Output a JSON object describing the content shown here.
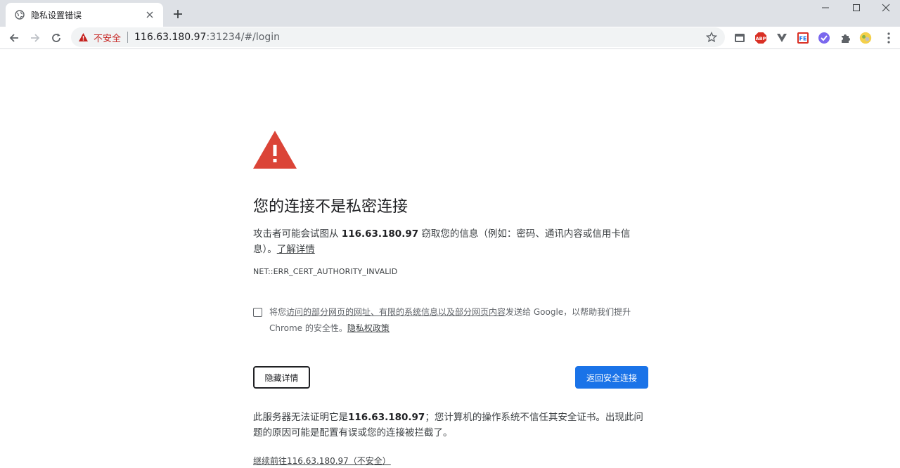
{
  "tab": {
    "title": "隐私设置错误"
  },
  "omnibox": {
    "security_label": "不安全",
    "host": "116.63.180.97",
    "path": ":31234/#/login"
  },
  "extensions": {
    "abp": "ABP",
    "fe": "FE"
  },
  "interstitial": {
    "heading": "您的连接不是私密连接",
    "main_text_pre": "攻击者可能会试图从 ",
    "main_host": "116.63.180.97",
    "main_text_post": " 窃取您的信息（例如：密码、通讯内容或信用卡信息）。",
    "learn_more": "了解详情",
    "error_code": "NET::ERR_CERT_AUTHORITY_INVALID",
    "optin_pre": "将您",
    "optin_link": "访问的部分网页的网址、有限的系统信息以及部分网页内容",
    "optin_post": "发送给 Google，以帮助我们提升 Chrome 的安全性。",
    "privacy_link": "隐私权政策",
    "hide_details_button": "隐藏详情",
    "back_button": "返回安全连接",
    "details_pre": "此服务器无法证明它是",
    "details_host": "116.63.180.97",
    "details_post": "；您计算机的操作系统不信任其安全证书。出现此问题的原因可能是配置有误或您的连接被拦截了。",
    "proceed_link": "继续前往116.63.180.97（不安全）"
  },
  "colors": {
    "accent": "#1a73e8",
    "warning": "#db4437",
    "insecure": "#c5221f"
  }
}
